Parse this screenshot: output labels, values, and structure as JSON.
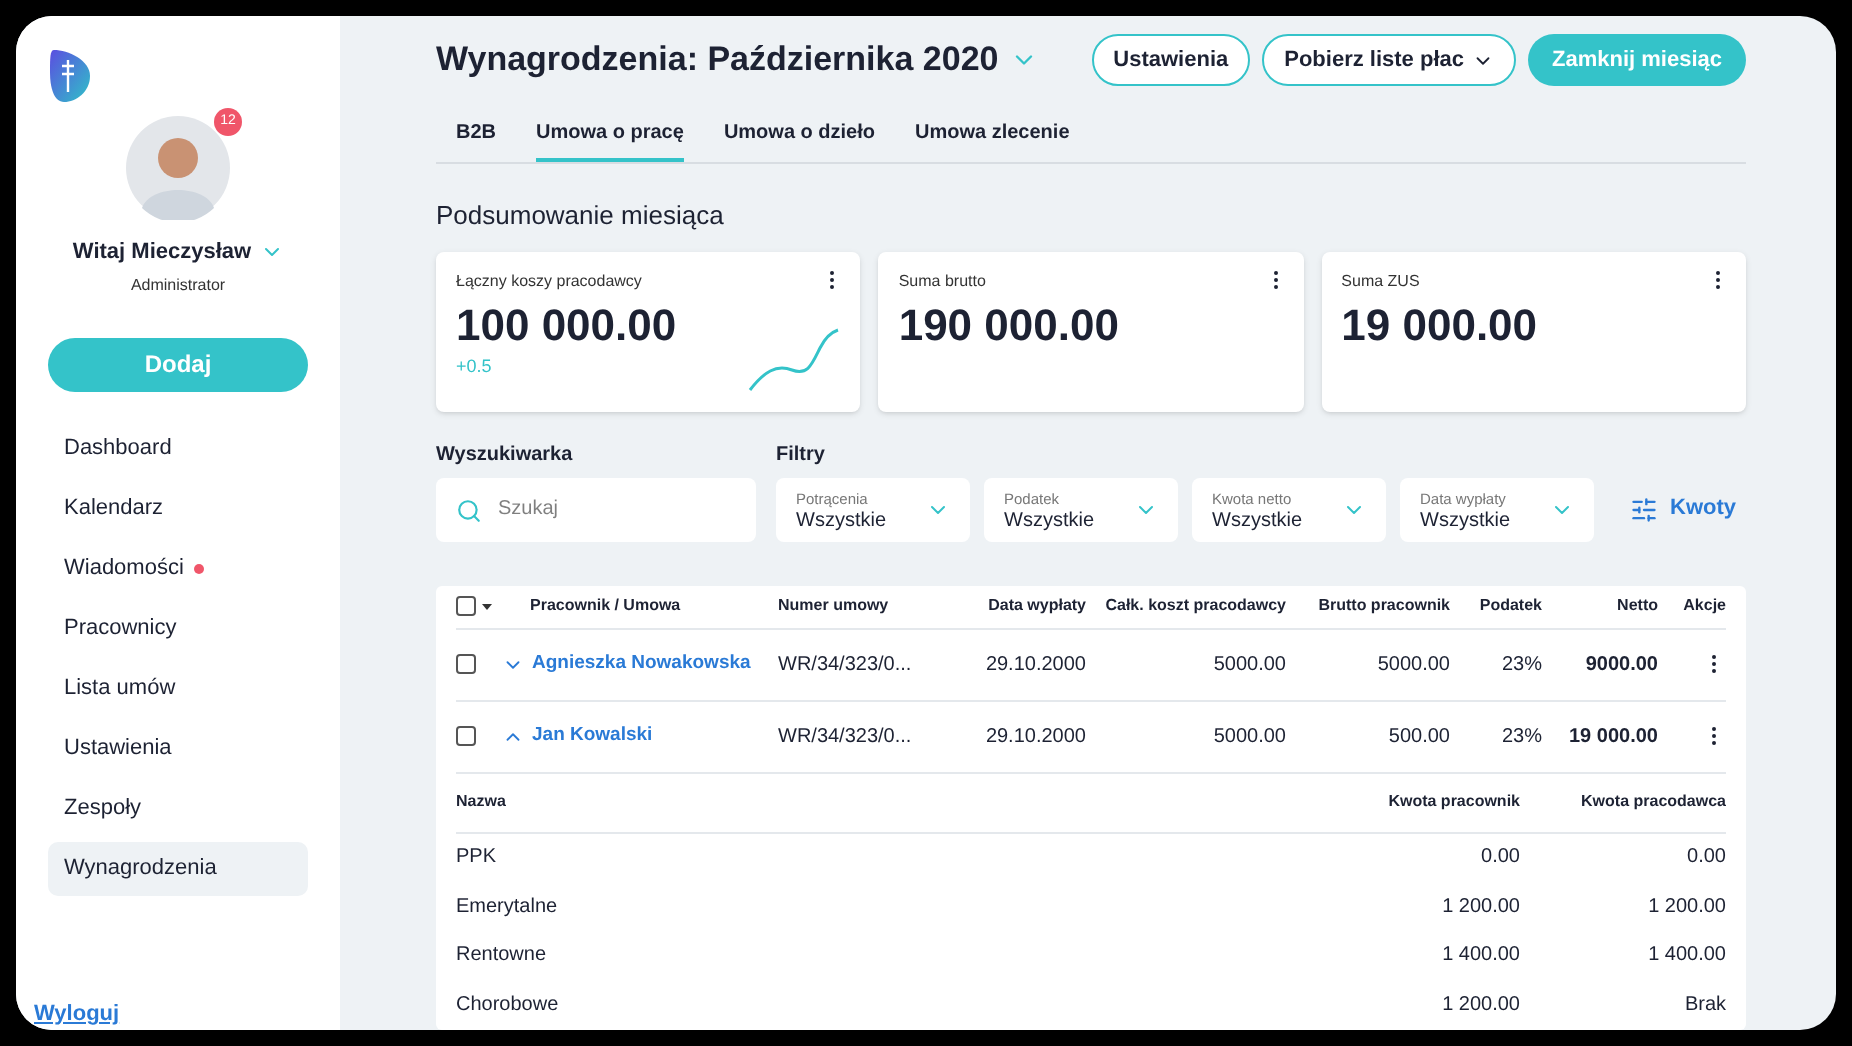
{
  "sidebar": {
    "user": {
      "greeting": "Witaj Mieczysław",
      "role": "Administrator",
      "badge": "12"
    },
    "add_button": "Dodaj",
    "items": [
      {
        "label": "Dashboard",
        "selected": false,
        "unread": false
      },
      {
        "label": "Kalendarz",
        "selected": false,
        "unread": false
      },
      {
        "label": "Wiadomości",
        "selected": false,
        "unread": true
      },
      {
        "label": "Pracownicy",
        "selected": false,
        "unread": false
      },
      {
        "label": "Lista umów",
        "selected": false,
        "unread": false
      },
      {
        "label": "Ustawienia",
        "selected": false,
        "unread": false
      },
      {
        "label": "Zespoły",
        "selected": false,
        "unread": false
      },
      {
        "label": "Wynagrodzenia",
        "selected": true,
        "unread": false
      }
    ],
    "logout": "Wyloguj"
  },
  "header": {
    "title": "Wynagrodzenia: Października 2020",
    "buttons": [
      {
        "label": "Ustawienia",
        "kind": "outline"
      },
      {
        "label": "Pobierz liste płac",
        "kind": "dropdown"
      },
      {
        "label": "Zamknij miesiąc",
        "kind": "primary"
      }
    ]
  },
  "tabs": [
    {
      "label": "B2B",
      "selected": false
    },
    {
      "label": "Umowa o pracę",
      "selected": true
    },
    {
      "label": "Umowa o dzieło",
      "selected": false
    },
    {
      "label": "Umowa zlecenie",
      "selected": false
    }
  ],
  "summary": {
    "title": "Podsumowanie miesiąca",
    "cards": [
      {
        "label": "Łączny koszy pracodawcy",
        "value": "100 000.00",
        "delta": "+0.5",
        "sparkline": true
      },
      {
        "label": "Suma brutto",
        "value": "190 000.00"
      },
      {
        "label": "Suma ZUS",
        "value": "19 000.00"
      }
    ]
  },
  "search": {
    "label": "Wyszukiwarka",
    "placeholder": "Szukaj"
  },
  "filters": {
    "label": "Filtry",
    "items": [
      {
        "label": "Potrącenia",
        "value": "Wszystkie"
      },
      {
        "label": "Podatek",
        "value": "Wszystkie"
      },
      {
        "label": "Kwota netto",
        "value": "Wszystkie"
      },
      {
        "label": "Data wypłaty",
        "value": "Wszystkie"
      }
    ],
    "amounts_button": "Kwoty"
  },
  "table": {
    "select_all_checked": false,
    "columns": [
      "Pracownik / Umowa",
      "Numer umowy",
      "Data wypłaty",
      "Całk. koszt pracodawcy",
      "Brutto pracownik",
      "Podatek",
      "Netto",
      "Akcje"
    ],
    "rows": [
      {
        "checked": false,
        "expanded": false,
        "name": "Agnieszka Nowakowska",
        "contract": "WR/34/323/0...",
        "date": "29.10.2000",
        "cost": "5000.00",
        "gross": "5000.00",
        "tax": "23%",
        "net": "9000.00"
      },
      {
        "checked": false,
        "expanded": true,
        "name": "Jan Kowalski",
        "contract": "WR/34/323/0...",
        "date": "29.10.2000",
        "cost": "5000.00",
        "gross": "500.00",
        "tax": "23%",
        "net": "19 000.00"
      }
    ],
    "details": {
      "columns": [
        "Nazwa",
        "Kwota pracownik",
        "Kwota pracodawca"
      ],
      "rows": [
        [
          "PPK",
          "0.00",
          "0.00"
        ],
        [
          "Emerytalne",
          "1 200.00",
          "1 200.00"
        ],
        [
          "Rentowne",
          "1 400.00",
          "1 400.00"
        ],
        [
          "Chorobowe",
          "1 200.00",
          "Brak"
        ]
      ]
    }
  }
}
